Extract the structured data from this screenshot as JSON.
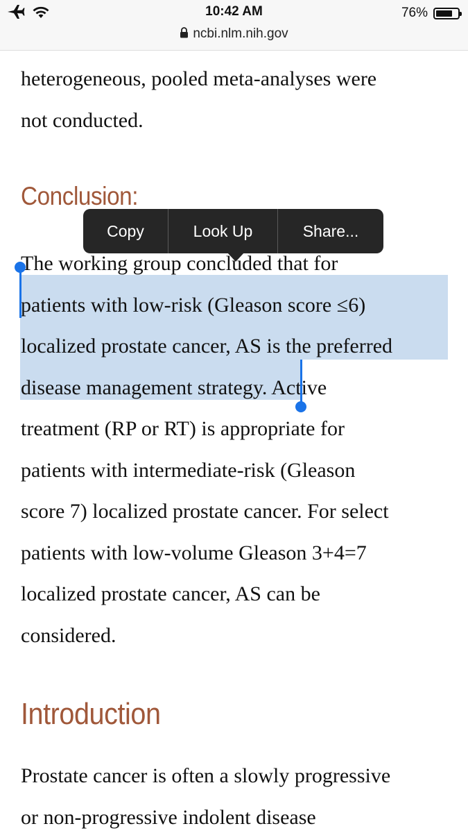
{
  "status_bar": {
    "time": "10:42 AM",
    "battery_percent": "76%",
    "battery_level": 0.76,
    "icons": [
      "airplane-icon",
      "wifi-icon",
      "battery-icon"
    ]
  },
  "address_bar": {
    "url": "ncbi.nlm.nih.gov",
    "icon": "lock-icon"
  },
  "article": {
    "top_paragraph_lines": [
      "heterogeneous, pooled meta-analyses were",
      "not conducted."
    ],
    "conclusion_heading": "Conclusion:",
    "conclusion_lines": [
      "The working group concluded that for",
      "patients with low-risk (Gleason score ≤6)",
      "localized prostate cancer, AS is the preferred",
      "disease management strategy.",
      " Active",
      "treatment (RP or RT) is appropriate for",
      "patients with intermediate-risk (Gleason",
      "score 7) localized prostate cancer. For select",
      "patients with low-volume Gleason 3+4=7",
      "localized prostate cancer, AS can be",
      "considered."
    ],
    "introduction_heading": "Introduction",
    "introduction_lines": [
      "Prostate cancer is often a slowly progressive",
      "or non-progressive indolent disease"
    ]
  },
  "selection_menu": {
    "copy_label": "Copy",
    "look_up_label": "Look Up",
    "share_label": "Share..."
  },
  "colors": {
    "heading": "#a0583a",
    "selection_highlight": "#cadcef",
    "selection_handle": "#1a73e8",
    "callout_background": "#262626"
  }
}
